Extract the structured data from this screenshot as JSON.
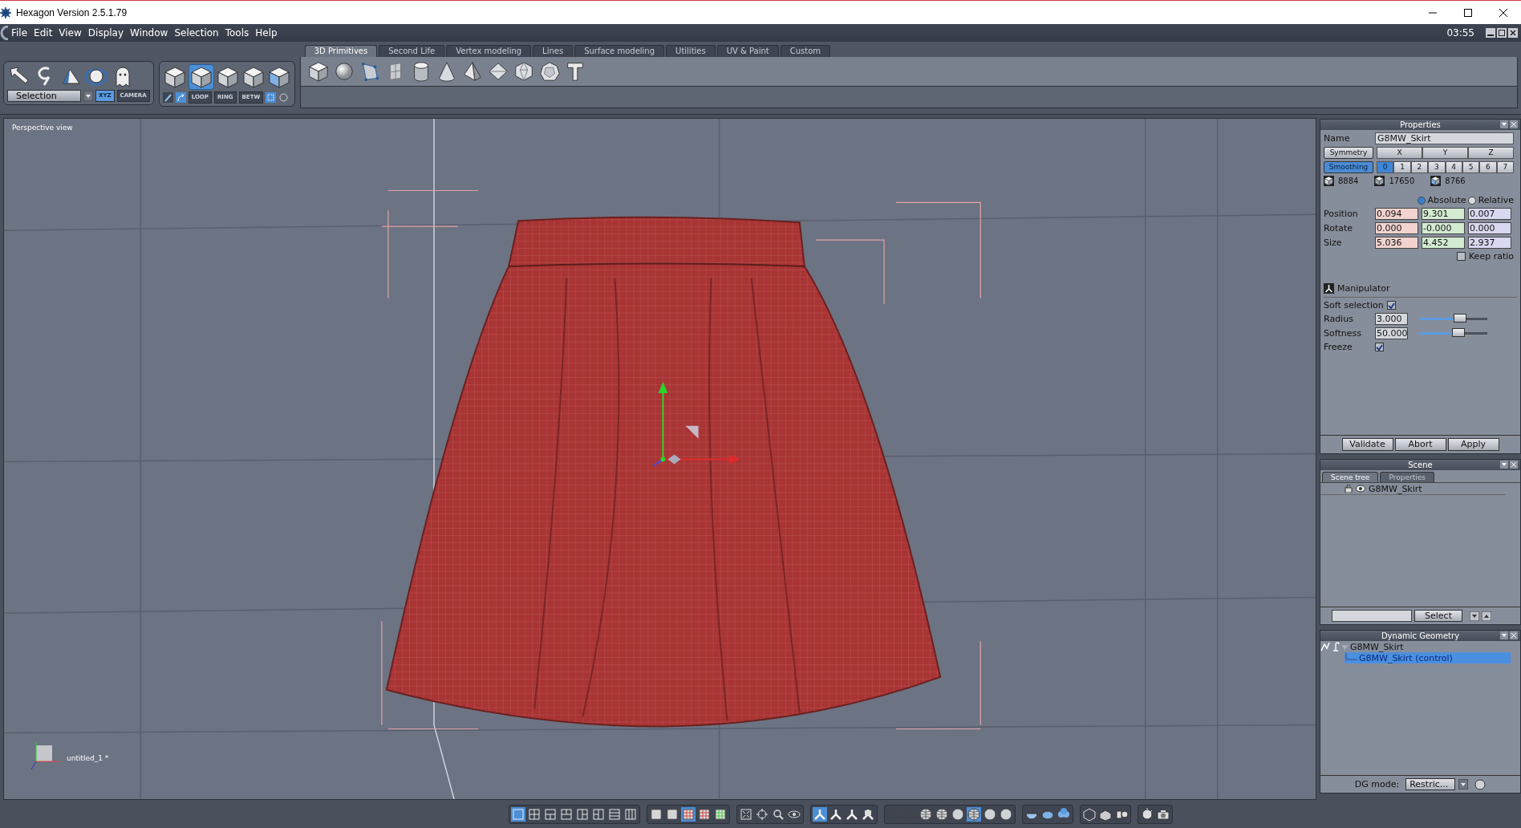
{
  "window": {
    "title": "Hexagon Version 2.5.1.79"
  },
  "menu": [
    "File",
    "Edit",
    "View",
    "Display",
    "Window",
    "Selection",
    "Tools",
    "Help"
  ],
  "clock": "03:55",
  "selection_toolbar": {
    "mode": "Selection",
    "spaces": [
      {
        "label": "XYZ",
        "selected": true
      },
      {
        "label": "CAMERA",
        "selected": false
      }
    ]
  },
  "component_toolbar": {
    "modes": [
      {
        "selected": false
      },
      {
        "selected": true
      },
      {
        "selected": false
      },
      {
        "selected": false
      },
      {
        "selected": false
      }
    ],
    "buttons": [
      "LOOP",
      "RING",
      "BETW"
    ]
  },
  "tabs": [
    {
      "label": "3D Primitives",
      "selected": true
    },
    {
      "label": "Second Life",
      "selected": false
    },
    {
      "label": "Vertex modeling",
      "selected": false
    },
    {
      "label": "Lines",
      "selected": false
    },
    {
      "label": "Surface modeling",
      "selected": false
    },
    {
      "label": "Utilities",
      "selected": false
    },
    {
      "label": "UV & Paint",
      "selected": false
    },
    {
      "label": "Custom",
      "selected": false
    }
  ],
  "viewport": {
    "title": "Perspective view",
    "file_label": "untitled_1 *"
  },
  "properties": {
    "title": "Properties",
    "name_label": "Name",
    "name": "G8MW_Skirt",
    "symmetry": {
      "label": "Symmetry",
      "axes": [
        "X",
        "Y",
        "Z"
      ]
    },
    "smoothing": {
      "label": "Smoothing",
      "levels": [
        {
          "label": "0",
          "selected": true
        },
        {
          "label": "1",
          "selected": false
        },
        {
          "label": "2",
          "selected": false
        },
        {
          "label": "3",
          "selected": false
        },
        {
          "label": "4",
          "selected": false
        },
        {
          "label": "5",
          "selected": false
        },
        {
          "label": "6",
          "selected": false
        },
        {
          "label": "7",
          "selected": false
        }
      ]
    },
    "counts": [
      "8884",
      "17650",
      "8766"
    ],
    "modes": [
      {
        "label": "Absolute",
        "selected": true
      },
      {
        "label": "Relative",
        "selected": false
      }
    ],
    "rows": [
      {
        "label": "Position",
        "values": [
          "0.094",
          "9.301",
          "0.007"
        ]
      },
      {
        "label": "Rotate",
        "values": [
          "0.000",
          "-0.000",
          "0.000"
        ]
      },
      {
        "label": "Size",
        "values": [
          "5.036",
          "4.452",
          "2.937"
        ]
      }
    ],
    "keep_ratio": {
      "label": "Keep ratio",
      "checked": false
    },
    "manipulator": "Manipulator",
    "soft_selection": {
      "label": "Soft selection",
      "checked": true
    },
    "sliders": [
      {
        "label": "Radius",
        "value": "3.000",
        "level": 0.6
      },
      {
        "label": "Softness",
        "value": "50.000",
        "level": 0.58
      }
    ],
    "freeze": {
      "label": "Freeze",
      "checked": true
    },
    "buttons": [
      "Validate",
      "Abort",
      "Apply"
    ]
  },
  "scene": {
    "title": "Scene",
    "tabs": [
      {
        "label": "Scene tree",
        "selected": true
      },
      {
        "label": "Properties",
        "selected": false
      }
    ],
    "items": [
      "G8MW_Skirt"
    ],
    "select_button": "Select"
  },
  "dynamic_geometry": {
    "title": "Dynamic Geometry",
    "tree": [
      {
        "label": "G8MW_Skirt",
        "expanded": true,
        "selected": false,
        "children": [
          {
            "label": "G8MW_Skirt (control)",
            "selected": true
          }
        ]
      }
    ],
    "mode_label": "DG mode:",
    "mode_value": "Restric..."
  },
  "bottom_toolbar": {
    "layouts": [
      {
        "selected": true
      },
      {
        "selected": false
      },
      {
        "selected": false
      },
      {
        "selected": false
      },
      {
        "selected": false
      },
      {
        "selected": false
      },
      {
        "selected": false
      },
      {
        "selected": false
      }
    ],
    "grids": [
      {
        "selected": false
      },
      {
        "selected": false
      },
      {
        "selected": true
      },
      {
        "selected": false
      },
      {
        "selected": false
      }
    ],
    "manipulators": [
      {
        "selected": true
      },
      {
        "selected": false
      },
      {
        "selected": false
      },
      {
        "selected": false
      }
    ],
    "shading": [
      {
        "selected": false
      },
      {
        "selected": false
      },
      {
        "selected": false
      },
      {
        "selected": false
      },
      {
        "selected": false
      },
      {
        "selected": true
      },
      {
        "selected": false
      },
      {
        "selected": false
      }
    ]
  }
}
